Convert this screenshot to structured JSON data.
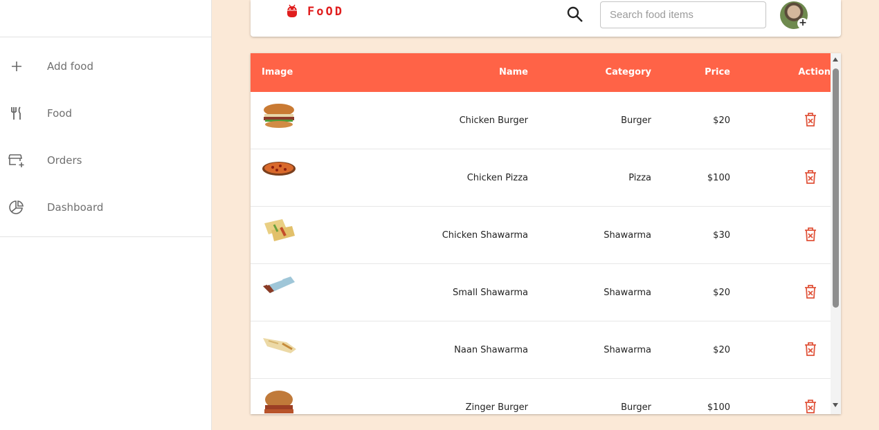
{
  "sidebar": {
    "items": [
      {
        "label": "Add food",
        "icon": "plus-icon"
      },
      {
        "label": "Food",
        "icon": "fork-knife-icon"
      },
      {
        "label": "Orders",
        "icon": "store-add-icon"
      },
      {
        "label": "Dashboard",
        "icon": "pie-chart-icon"
      }
    ]
  },
  "header": {
    "logo_text": "FoOD",
    "search_placeholder": "Search food items",
    "search_value": ""
  },
  "table": {
    "columns": {
      "image": "Image",
      "name": "Name",
      "category": "Category",
      "price": "Price",
      "action": "Action"
    },
    "rows": [
      {
        "name": "Chicken Burger",
        "category": "Burger",
        "price": "$20",
        "thumb": "burger"
      },
      {
        "name": "Chicken Pizza",
        "category": "Pizza",
        "price": "$100",
        "thumb": "pizza"
      },
      {
        "name": "Chicken Shawarma",
        "category": "Shawarma",
        "price": "$30",
        "thumb": "wrap"
      },
      {
        "name": "Small Shawarma",
        "category": "Shawarma",
        "price": "$20",
        "thumb": "small-wrap"
      },
      {
        "name": "Naan Shawarma",
        "category": "Shawarma",
        "price": "$20",
        "thumb": "naan"
      },
      {
        "name": "Zinger Burger",
        "category": "Burger",
        "price": "$100",
        "thumb": "burger"
      }
    ]
  },
  "colors": {
    "accent": "#ff6347",
    "background": "#fbe9d7",
    "logo": "#e01d1d",
    "delete_icon": "#e0533a"
  }
}
